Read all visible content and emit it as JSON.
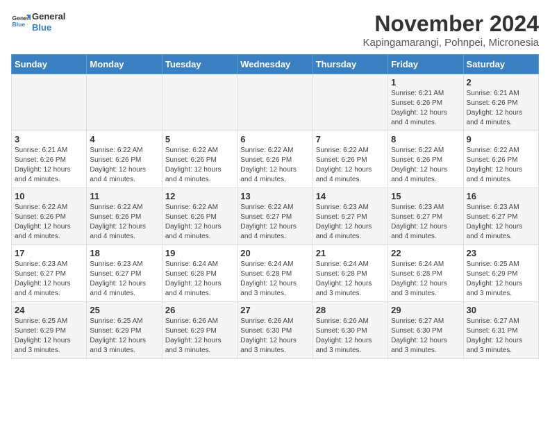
{
  "header": {
    "logo_line1": "General",
    "logo_line2": "Blue",
    "month": "November 2024",
    "location": "Kapingamarangi, Pohnpei, Micronesia"
  },
  "days_of_week": [
    "Sunday",
    "Monday",
    "Tuesday",
    "Wednesday",
    "Thursday",
    "Friday",
    "Saturday"
  ],
  "weeks": [
    [
      {
        "day": "",
        "info": ""
      },
      {
        "day": "",
        "info": ""
      },
      {
        "day": "",
        "info": ""
      },
      {
        "day": "",
        "info": ""
      },
      {
        "day": "",
        "info": ""
      },
      {
        "day": "1",
        "info": "Sunrise: 6:21 AM\nSunset: 6:26 PM\nDaylight: 12 hours and 4 minutes."
      },
      {
        "day": "2",
        "info": "Sunrise: 6:21 AM\nSunset: 6:26 PM\nDaylight: 12 hours and 4 minutes."
      }
    ],
    [
      {
        "day": "3",
        "info": "Sunrise: 6:21 AM\nSunset: 6:26 PM\nDaylight: 12 hours and 4 minutes."
      },
      {
        "day": "4",
        "info": "Sunrise: 6:22 AM\nSunset: 6:26 PM\nDaylight: 12 hours and 4 minutes."
      },
      {
        "day": "5",
        "info": "Sunrise: 6:22 AM\nSunset: 6:26 PM\nDaylight: 12 hours and 4 minutes."
      },
      {
        "day": "6",
        "info": "Sunrise: 6:22 AM\nSunset: 6:26 PM\nDaylight: 12 hours and 4 minutes."
      },
      {
        "day": "7",
        "info": "Sunrise: 6:22 AM\nSunset: 6:26 PM\nDaylight: 12 hours and 4 minutes."
      },
      {
        "day": "8",
        "info": "Sunrise: 6:22 AM\nSunset: 6:26 PM\nDaylight: 12 hours and 4 minutes."
      },
      {
        "day": "9",
        "info": "Sunrise: 6:22 AM\nSunset: 6:26 PM\nDaylight: 12 hours and 4 minutes."
      }
    ],
    [
      {
        "day": "10",
        "info": "Sunrise: 6:22 AM\nSunset: 6:26 PM\nDaylight: 12 hours and 4 minutes."
      },
      {
        "day": "11",
        "info": "Sunrise: 6:22 AM\nSunset: 6:26 PM\nDaylight: 12 hours and 4 minutes."
      },
      {
        "day": "12",
        "info": "Sunrise: 6:22 AM\nSunset: 6:26 PM\nDaylight: 12 hours and 4 minutes."
      },
      {
        "day": "13",
        "info": "Sunrise: 6:22 AM\nSunset: 6:27 PM\nDaylight: 12 hours and 4 minutes."
      },
      {
        "day": "14",
        "info": "Sunrise: 6:23 AM\nSunset: 6:27 PM\nDaylight: 12 hours and 4 minutes."
      },
      {
        "day": "15",
        "info": "Sunrise: 6:23 AM\nSunset: 6:27 PM\nDaylight: 12 hours and 4 minutes."
      },
      {
        "day": "16",
        "info": "Sunrise: 6:23 AM\nSunset: 6:27 PM\nDaylight: 12 hours and 4 minutes."
      }
    ],
    [
      {
        "day": "17",
        "info": "Sunrise: 6:23 AM\nSunset: 6:27 PM\nDaylight: 12 hours and 4 minutes."
      },
      {
        "day": "18",
        "info": "Sunrise: 6:23 AM\nSunset: 6:27 PM\nDaylight: 12 hours and 4 minutes."
      },
      {
        "day": "19",
        "info": "Sunrise: 6:24 AM\nSunset: 6:28 PM\nDaylight: 12 hours and 4 minutes."
      },
      {
        "day": "20",
        "info": "Sunrise: 6:24 AM\nSunset: 6:28 PM\nDaylight: 12 hours and 3 minutes."
      },
      {
        "day": "21",
        "info": "Sunrise: 6:24 AM\nSunset: 6:28 PM\nDaylight: 12 hours and 3 minutes."
      },
      {
        "day": "22",
        "info": "Sunrise: 6:24 AM\nSunset: 6:28 PM\nDaylight: 12 hours and 3 minutes."
      },
      {
        "day": "23",
        "info": "Sunrise: 6:25 AM\nSunset: 6:29 PM\nDaylight: 12 hours and 3 minutes."
      }
    ],
    [
      {
        "day": "24",
        "info": "Sunrise: 6:25 AM\nSunset: 6:29 PM\nDaylight: 12 hours and 3 minutes."
      },
      {
        "day": "25",
        "info": "Sunrise: 6:25 AM\nSunset: 6:29 PM\nDaylight: 12 hours and 3 minutes."
      },
      {
        "day": "26",
        "info": "Sunrise: 6:26 AM\nSunset: 6:29 PM\nDaylight: 12 hours and 3 minutes."
      },
      {
        "day": "27",
        "info": "Sunrise: 6:26 AM\nSunset: 6:30 PM\nDaylight: 12 hours and 3 minutes."
      },
      {
        "day": "28",
        "info": "Sunrise: 6:26 AM\nSunset: 6:30 PM\nDaylight: 12 hours and 3 minutes."
      },
      {
        "day": "29",
        "info": "Sunrise: 6:27 AM\nSunset: 6:30 PM\nDaylight: 12 hours and 3 minutes."
      },
      {
        "day": "30",
        "info": "Sunrise: 6:27 AM\nSunset: 6:31 PM\nDaylight: 12 hours and 3 minutes."
      }
    ]
  ]
}
